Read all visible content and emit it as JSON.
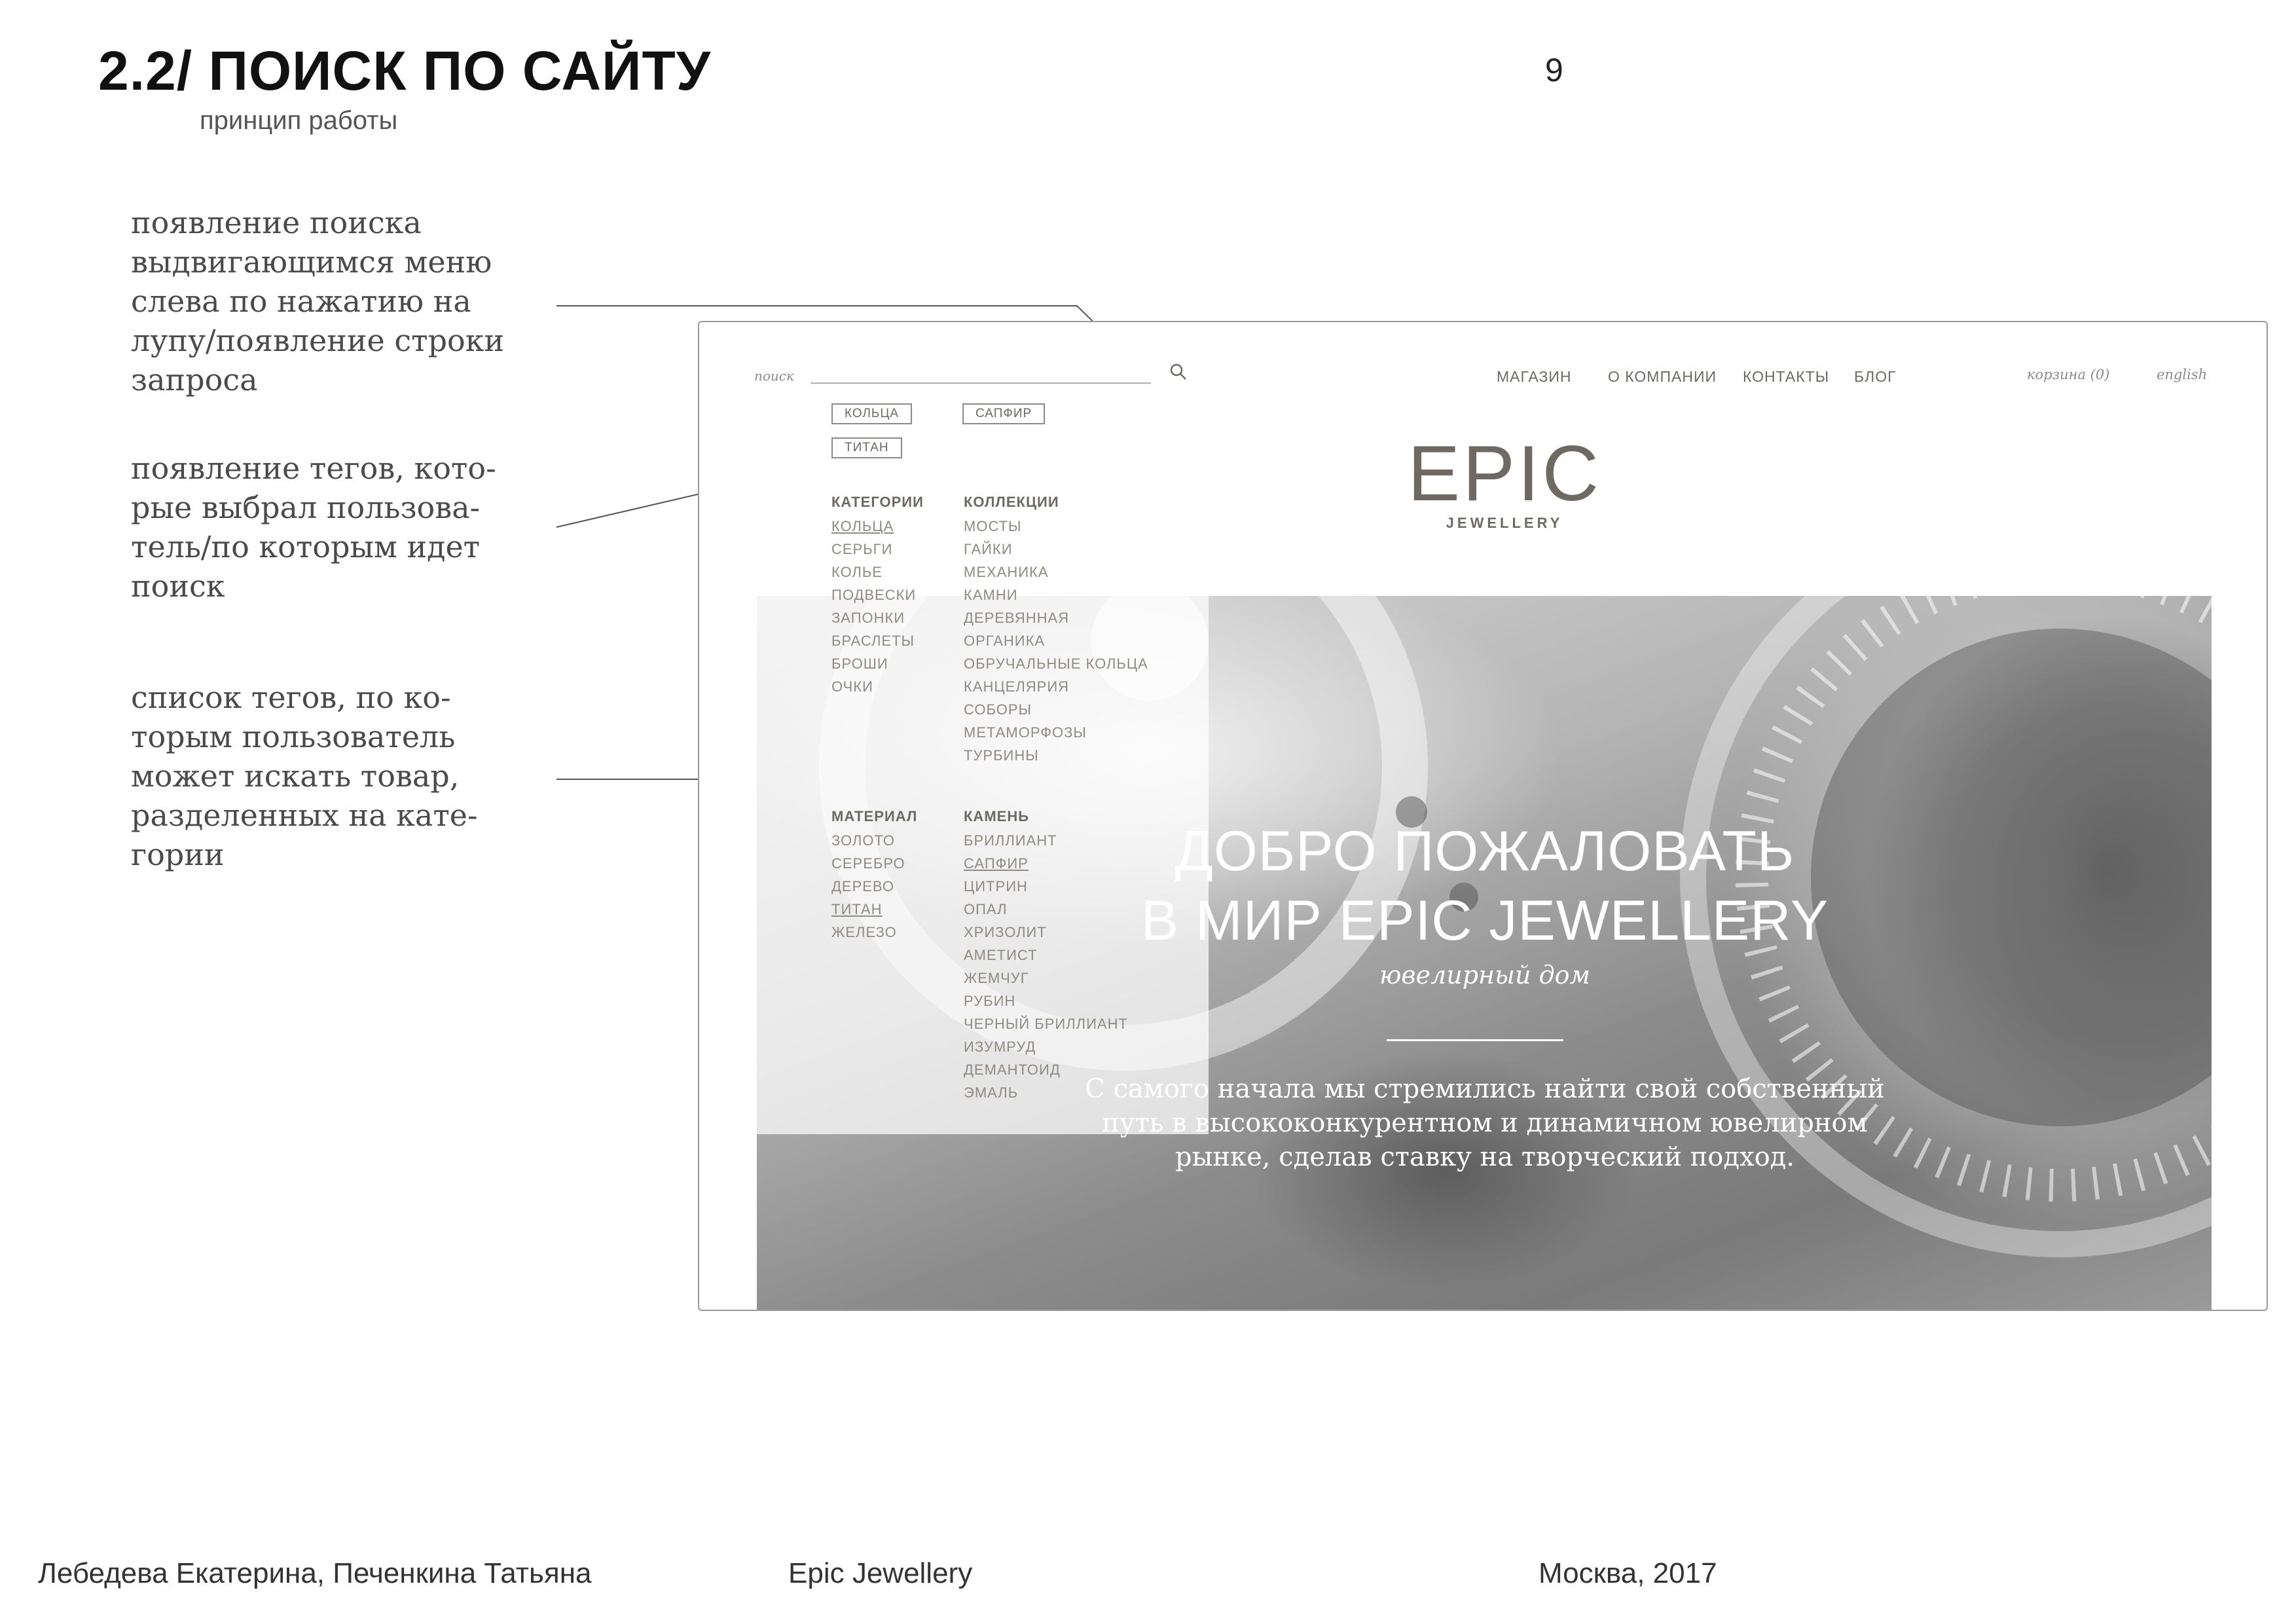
{
  "header": {
    "title": "2.2/ ПОИСК ПО САЙТУ",
    "subtitle": "принцип работы",
    "page_number": "9"
  },
  "annotations": [
    {
      "lines": [
        "появление поиска",
        "выдвигающимся меню",
        "слева по нажатию на",
        "лупу/появление строки",
        "запроса"
      ]
    },
    {
      "lines": [
        "появление тегов, кото-",
        "рые выбрал пользова-",
        "тель/по которым идет",
        "поиск"
      ]
    },
    {
      "lines": [
        "список тегов, по ко-",
        "торым пользователь",
        "может искать товар,",
        "разделенных на кате-",
        "гории"
      ]
    }
  ],
  "site": {
    "search_placeholder": "поиск",
    "nav": [
      "МАГАЗИН",
      "О КОМПАНИИ",
      "КОНТАКТЫ",
      "БЛОГ"
    ],
    "cart": "корзина (0)",
    "language": "english",
    "selected_tags": [
      "КОЛЬЦА",
      "САПФИР",
      "ТИТАН"
    ],
    "logo_text": "EPIC",
    "logo_sub": "JEWELLERY",
    "columns": [
      {
        "title": "КАТЕГОРИИ",
        "items": [
          "КОЛЬЦА",
          "СЕРЬГИ",
          "КОЛЬЕ",
          "ПОДВЕСКИ",
          "ЗАПОНКИ",
          "БРАСЛЕТЫ",
          "БРОШИ",
          "ОЧКИ"
        ],
        "selected": [
          0
        ]
      },
      {
        "title": "КОЛЛЕКЦИИ",
        "items": [
          "МОСТЫ",
          "ГАЙКИ",
          "МЕХАНИКА",
          "КАМНИ",
          "ДЕРЕВЯННАЯ",
          "ОРГАНИКА",
          "ОБРУЧАЛЬНЫЕ КОЛЬЦА",
          "КАНЦЕЛЯРИЯ",
          "СОБОРЫ",
          "МЕТАМОРФОЗЫ",
          "ТУРБИНЫ"
        ],
        "selected": []
      },
      {
        "title": "МАТЕРИАЛ",
        "items": [
          "ЗОЛОТО",
          "СЕРЕБРО",
          "ДЕРЕВО",
          "ТИТАН",
          "ЖЕЛЕЗО"
        ],
        "selected": [
          3
        ]
      },
      {
        "title": "КАМЕНЬ",
        "items": [
          "БРИЛЛИАНТ",
          "САПФИР",
          "ЦИТРИН",
          "ОПАЛ",
          "ХРИЗОЛИТ",
          "АМЕТИСТ",
          "ЖЕМЧУГ",
          "РУБИН",
          "ЧЕРНЫЙ БРИЛЛИАНТ",
          "ИЗУМРУД",
          "ДЕМАНТОИД",
          "ЭМАЛЬ"
        ],
        "selected": [
          1
        ]
      }
    ],
    "hero_title_line1": "ДОБРО ПОЖАЛОВАТЬ",
    "hero_title_line2": "В МИР EPIC JEWELLERY",
    "hero_subtitle": "ювелирный дом",
    "hero_text_line1": "С самого начала мы стремились найти свой собственный",
    "hero_text_line2": "путь в высококонкурентном и динамичном ювелирном",
    "hero_text_line3": "рынке, сделав ставку на творческий подход."
  },
  "footer": {
    "authors": "Лебедева Екатерина, Печенкина Татьяна",
    "project": "Epic Jewellery",
    "place_year": "Москва, 2017"
  },
  "colors": {
    "nav_text": "#6e6a63",
    "logo": "#6e6a63",
    "tag_border": "#8a8a8a",
    "hero_text": "#ffffff"
  }
}
